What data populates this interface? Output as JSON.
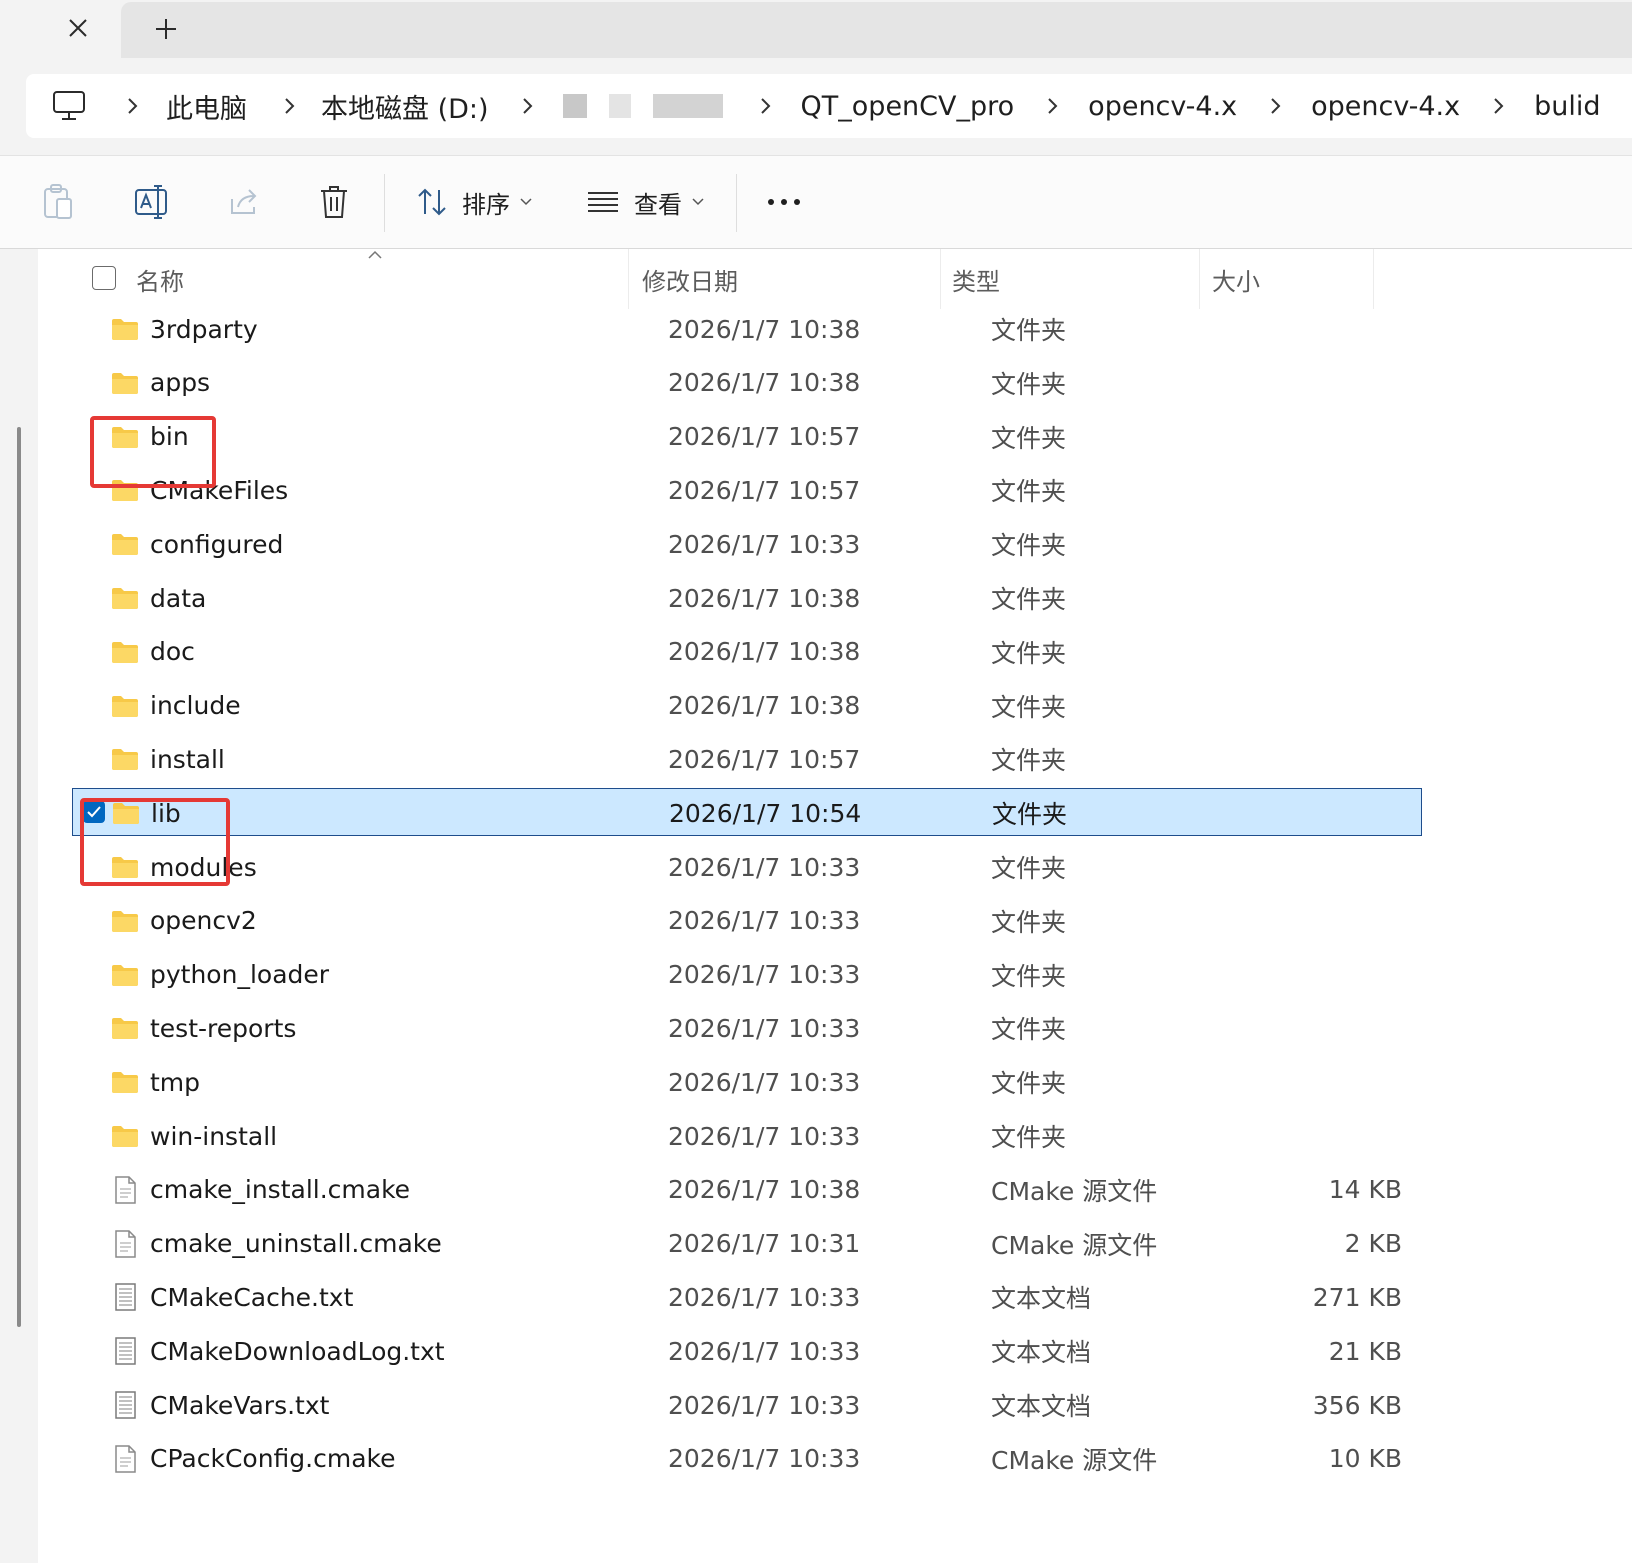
{
  "tabs": {
    "close_icon": "close-icon",
    "new_tab_icon": "plus-icon"
  },
  "address": {
    "root_icon": "this-pc-icon",
    "segments": [
      "此电脑",
      "本地磁盘 (D:)",
      "QT_openCV_pro",
      "opencv-4.x",
      "opencv-4.x",
      "bulid"
    ]
  },
  "commandbar": {
    "icons": [
      "paste-icon",
      "rename-icon",
      "share-icon",
      "delete-icon"
    ],
    "sort_label": "排序",
    "view_label": "查看",
    "more_icon": "more-icon"
  },
  "columns": {
    "name": "名称",
    "date": "修改日期",
    "type": "类型",
    "size": "大小"
  },
  "files": [
    {
      "name": "3rdparty",
      "date": "2026/1/7 10:38",
      "type": "文件夹",
      "size": "",
      "kind": "folder"
    },
    {
      "name": "apps",
      "date": "2026/1/7 10:38",
      "type": "文件夹",
      "size": "",
      "kind": "folder"
    },
    {
      "name": "bin",
      "date": "2026/1/7 10:57",
      "type": "文件夹",
      "size": "",
      "kind": "folder",
      "highlighted": true
    },
    {
      "name": "CMakeFiles",
      "date": "2026/1/7 10:57",
      "type": "文件夹",
      "size": "",
      "kind": "folder"
    },
    {
      "name": "configured",
      "date": "2026/1/7 10:33",
      "type": "文件夹",
      "size": "",
      "kind": "folder"
    },
    {
      "name": "data",
      "date": "2026/1/7 10:38",
      "type": "文件夹",
      "size": "",
      "kind": "folder"
    },
    {
      "name": "doc",
      "date": "2026/1/7 10:38",
      "type": "文件夹",
      "size": "",
      "kind": "folder"
    },
    {
      "name": "include",
      "date": "2026/1/7 10:38",
      "type": "文件夹",
      "size": "",
      "kind": "folder"
    },
    {
      "name": "install",
      "date": "2026/1/7 10:57",
      "type": "文件夹",
      "size": "",
      "kind": "folder"
    },
    {
      "name": "lib",
      "date": "2026/1/7 10:54",
      "type": "文件夹",
      "size": "",
      "kind": "folder",
      "selected": true,
      "highlighted": true
    },
    {
      "name": "modules",
      "date": "2026/1/7 10:33",
      "type": "文件夹",
      "size": "",
      "kind": "folder"
    },
    {
      "name": "opencv2",
      "date": "2026/1/7 10:33",
      "type": "文件夹",
      "size": "",
      "kind": "folder"
    },
    {
      "name": "python_loader",
      "date": "2026/1/7 10:33",
      "type": "文件夹",
      "size": "",
      "kind": "folder"
    },
    {
      "name": "test-reports",
      "date": "2026/1/7 10:33",
      "type": "文件夹",
      "size": "",
      "kind": "folder"
    },
    {
      "name": "tmp",
      "date": "2026/1/7 10:33",
      "type": "文件夹",
      "size": "",
      "kind": "folder"
    },
    {
      "name": "win-install",
      "date": "2026/1/7 10:33",
      "type": "文件夹",
      "size": "",
      "kind": "folder"
    },
    {
      "name": "cmake_install.cmake",
      "date": "2026/1/7 10:38",
      "type": "CMake 源文件",
      "size": "14 KB",
      "kind": "file"
    },
    {
      "name": "cmake_uninstall.cmake",
      "date": "2026/1/7 10:31",
      "type": "CMake 源文件",
      "size": "2 KB",
      "kind": "file"
    },
    {
      "name": "CMakeCache.txt",
      "date": "2026/1/7 10:33",
      "type": "文本文档",
      "size": "271 KB",
      "kind": "text"
    },
    {
      "name": "CMakeDownloadLog.txt",
      "date": "2026/1/7 10:33",
      "type": "文本文档",
      "size": "21 KB",
      "kind": "text"
    },
    {
      "name": "CMakeVars.txt",
      "date": "2026/1/7 10:33",
      "type": "文本文档",
      "size": "356 KB",
      "kind": "text"
    },
    {
      "name": "CPackConfig.cmake",
      "date": "2026/1/7 10:33",
      "type": "CMake 源文件",
      "size": "10 KB",
      "kind": "file"
    }
  ],
  "colors": {
    "selection_bg": "#cce8ff",
    "selection_border": "#1e4d8c",
    "annotation": "#e53935",
    "folder": "#f7c948",
    "checkbox": "#0067c0"
  }
}
